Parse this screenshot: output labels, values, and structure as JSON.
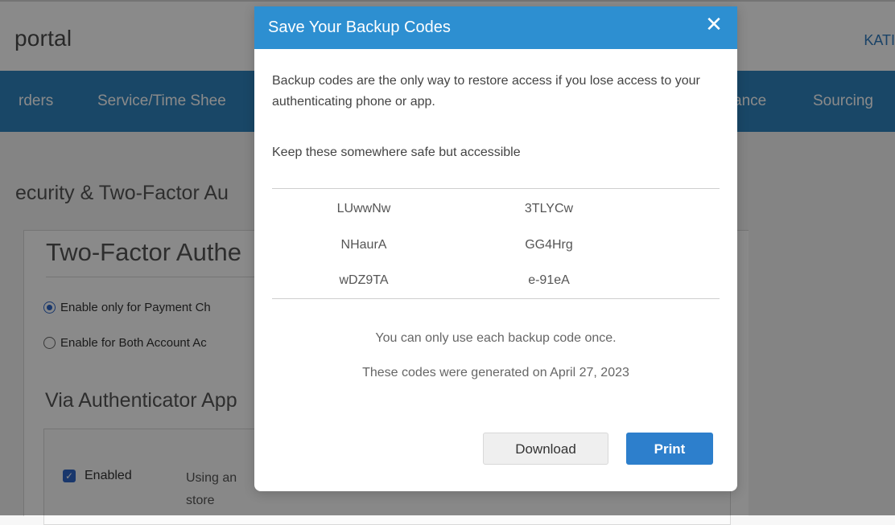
{
  "header": {
    "brand": "portal",
    "user_label": "KATI"
  },
  "nav": {
    "items": [
      {
        "label": "rders"
      },
      {
        "label": "Service/Time Shee"
      },
      {
        "label": "ance"
      },
      {
        "label": "Sourcing"
      }
    ]
  },
  "page": {
    "section_title": "ecurity & Two-Factor Au",
    "panel_heading": "Two-Factor Authe",
    "option_1": "Enable only for Payment Ch",
    "option_2": "Enable for Both Account Ac",
    "via_title": "Via Authenticator App",
    "enabled_label": "Enabled",
    "using_text": "Using an\nstore"
  },
  "modal": {
    "title": "Save Your Backup Codes",
    "close_label": "✕",
    "message": "Backup codes are the only way to restore access if you lose access to your authenticating phone or app.",
    "keep_safe": "Keep these somewhere safe but accessible",
    "codes": [
      "LUwwNw",
      "3TLYCw",
      "NHaurA",
      "GG4Hrg",
      "wDZ9TA",
      "e-91eA"
    ],
    "note_once": "You can only use each backup code once.",
    "note_generated": "These codes were generated on April 27, 2023",
    "download_label": "Download",
    "print_label": "Print"
  },
  "icons": {
    "radio_checked": "radio-selected-icon",
    "radio_unchecked": "radio-unselected-icon",
    "checkbox_checked": "checkbox-checked-icon",
    "close": "close-icon"
  },
  "colors": {
    "nav": "#2f84bf",
    "modal_header": "#2d8fd1",
    "primary_button": "#2d7fcc",
    "link": "#2f7bbf"
  }
}
